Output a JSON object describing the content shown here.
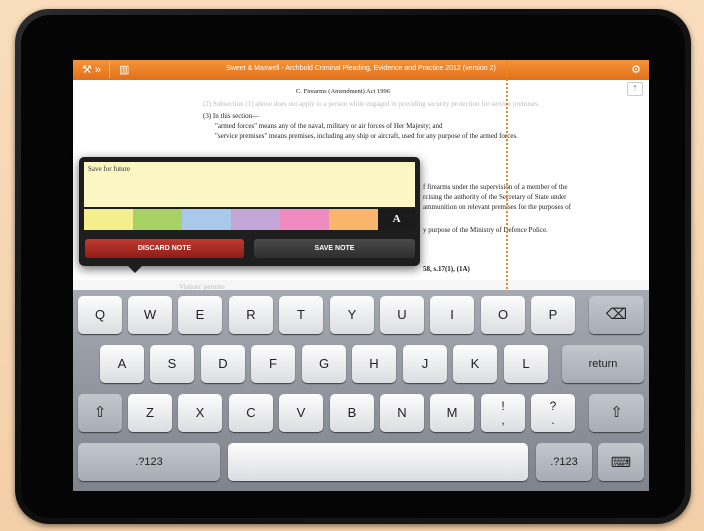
{
  "app": {
    "title": "Sweet & Maxwell - Archbold Criminal Pleading, Evidence and Practice 2012 (version 2)",
    "tools_icon": "tools-icon",
    "library_icon": "library-icon",
    "settings_icon": "settings-icon",
    "accent_color": "#e9791f"
  },
  "document": {
    "heading": "C. Firearms (Amendment) Act 1996",
    "lines": [
      "(2) Subsection (1) above does not apply to a person while engaged in providing security protection for service premises.",
      "(3) In this section—",
      "\"armed forces\" means any of the naval, military or air forces of Her Majesty; and",
      "\"service premises\" means premises, including any ship or aircraft, used for any purpose of the armed forces.",
      "f firearms under the supervision of a member of the",
      "rcising the authority of the Secretary of State under",
      "ammunition on relevant premises for the purposes of",
      "y purpose of the Ministry of Defence Police.",
      "58, s.17(1), (1A)",
      "Visitors' permits"
    ]
  },
  "note": {
    "text": "Save for future",
    "colors": [
      "#f4ef8c",
      "#a9d266",
      "#a9c9ec",
      "#c3a6d6",
      "#f08bc2",
      "#f8b56b"
    ],
    "font_button": "A",
    "discard_label": "DISCARD NOTE",
    "save_label": "SAVE NOTE"
  },
  "keyboard": {
    "row1": [
      "Q",
      "W",
      "E",
      "R",
      "T",
      "Y",
      "U",
      "I",
      "O",
      "P"
    ],
    "row2": [
      "A",
      "S",
      "D",
      "F",
      "G",
      "H",
      "J",
      "K",
      "L"
    ],
    "row3": [
      "Z",
      "X",
      "C",
      "V",
      "B",
      "N",
      "M"
    ],
    "backspace_icon": "backspace-icon",
    "return_label": "return",
    "shift_icon": "shift-icon",
    "exclam_top": "!",
    "exclam_bottom": ",",
    "question_top": "?",
    "question_bottom": ".",
    "numbers_label": ".?123",
    "dismiss_icon": "keyboard-dismiss-icon"
  }
}
